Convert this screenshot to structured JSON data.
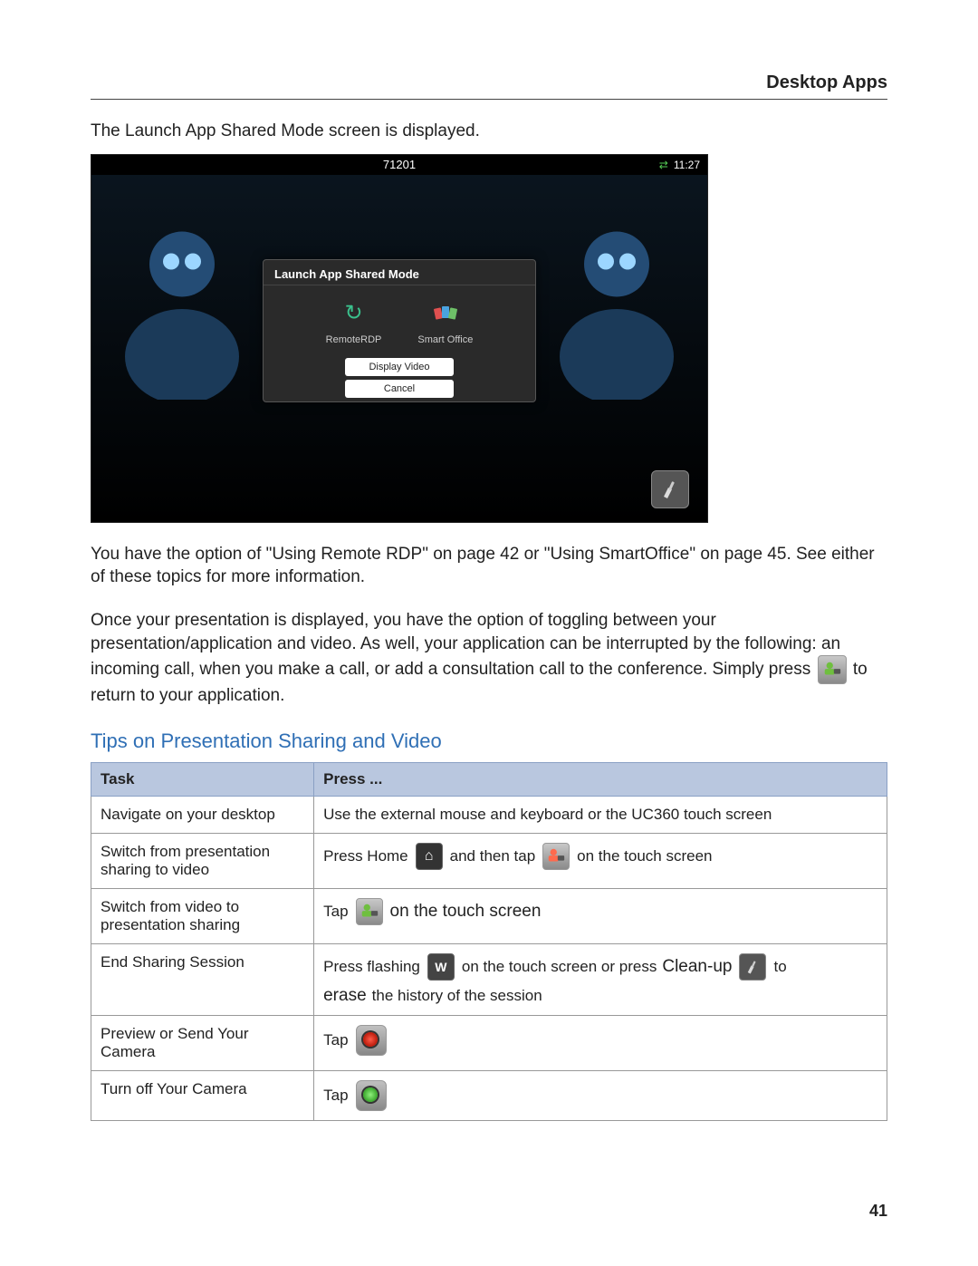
{
  "header": {
    "title": "Desktop Apps"
  },
  "intro": "The Launch App Shared Mode screen is displayed.",
  "screenshot": {
    "status_number": "71201",
    "time": "11:27",
    "modal_title": "Launch App Shared Mode",
    "app1": "RemoteRDP",
    "app2": "Smart Office",
    "btn_display": "Display Video",
    "btn_cancel": "Cancel"
  },
  "para2": "You have the option of \"Using Remote RDP\" on page 42 or \"Using SmartOffice\" on page 45. See either of these topics for more information.",
  "para3a": "Once your presentation is displayed, you have the option of toggling between your presentation/application and video. As well, your application can be interrupted by the following: an incoming call, when you make a call, or add a consultation call to the conference. Simply press",
  "para3b": "to return to your application.",
  "section_heading": "Tips on Presentation Sharing and Video",
  "table": {
    "col1": "Task",
    "col2": "Press ...",
    "rows": {
      "r1": {
        "task": "Navigate on your desktop",
        "press": "Use the external mouse and keyboard or the UC360 touch screen"
      },
      "r2": {
        "task": "Switch from presentation sharing to video",
        "p1": "Press Home",
        "p2": "and then tap",
        "p3": "on the touch screen"
      },
      "r3": {
        "task": "Switch from video to presentation sharing",
        "p1": "Tap",
        "p2": "on the touch screen"
      },
      "r4": {
        "task": "End Sharing Session",
        "p1": "Press flashing",
        "p2": "on the touch screen or press",
        "p3": "Clean-up",
        "p4": "to",
        "p5": "erase",
        "p6": "the history of the session"
      },
      "r5": {
        "task": "Preview or Send Your Camera",
        "p1": "Tap"
      },
      "r6": {
        "task": "Turn off Your Camera",
        "p1": "Tap"
      }
    }
  },
  "page_number": "41"
}
